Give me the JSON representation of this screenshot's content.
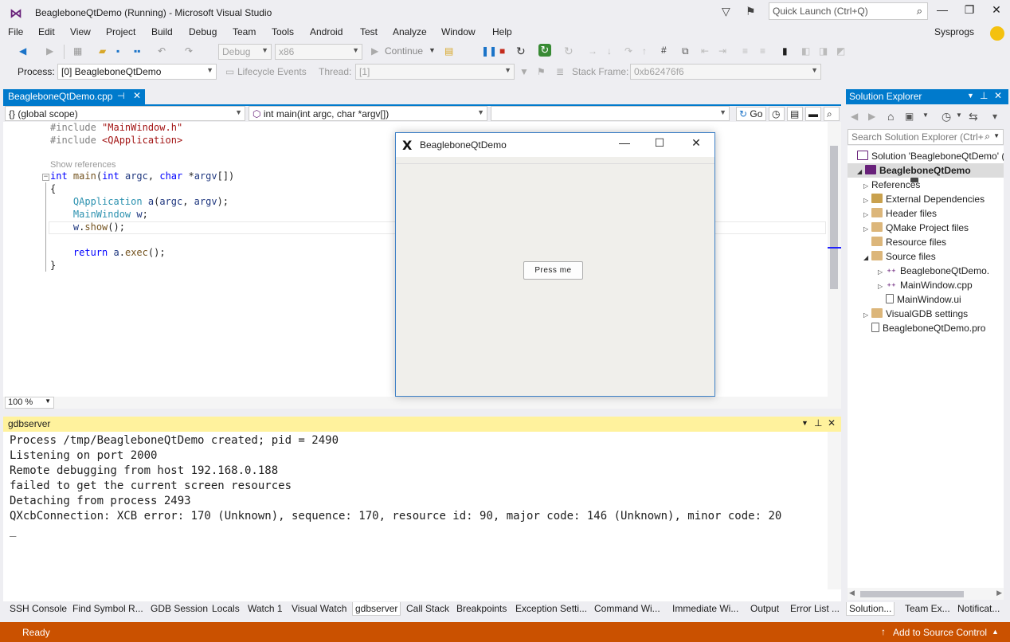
{
  "title_bar": {
    "title": "BeagleboneQtDemo (Running) - Microsoft Visual Studio",
    "quick_launch_placeholder": "Quick Launch (Ctrl+Q)"
  },
  "menu": {
    "items": [
      "File",
      "Edit",
      "View",
      "Project",
      "Build",
      "Debug",
      "Team",
      "Tools",
      "Android",
      "Test",
      "Analyze",
      "Window",
      "Help"
    ],
    "user": "Sysprogs"
  },
  "toolbar": {
    "config": "Debug",
    "platform": "x86",
    "continue_label": "Continue"
  },
  "debug_location": {
    "process_label": "Process:",
    "process_value": "[0] BeagleboneQtDemo",
    "lifecycle_label": "Lifecycle Events",
    "thread_label": "Thread:",
    "thread_value": "[1]",
    "stack_frame_label": "Stack Frame:",
    "stack_frame_value": "0xb62476f6"
  },
  "editor": {
    "tab_label": "BeagleboneQtDemo.cpp",
    "scope": "{} (global scope)",
    "function": "int main(int argc, char *argv[])",
    "go_label": "Go",
    "show_references": "Show references",
    "zoom": "100 %",
    "code_lines": [
      {
        "parts": [
          [
            "pp",
            "#include "
          ],
          [
            "str",
            "\"MainWindow.h\""
          ]
        ]
      },
      {
        "parts": [
          [
            "pp",
            "#include "
          ],
          [
            "str",
            "<QApplication>"
          ]
        ]
      },
      {
        "parts": [
          [
            "kw",
            "int"
          ],
          [
            "",
            " "
          ],
          [
            "fn",
            "main"
          ],
          [
            "",
            "("
          ],
          [
            "kw",
            "int"
          ],
          [
            "",
            " "
          ],
          [
            "va",
            "argc"
          ],
          [
            "",
            ", "
          ],
          [
            "kw",
            "char"
          ],
          [
            "",
            " *"
          ],
          [
            "va",
            "argv"
          ],
          [
            "",
            "[])"
          ]
        ]
      },
      {
        "parts": [
          [
            "",
            "{"
          ]
        ]
      },
      {
        "parts": [
          [
            "",
            "    "
          ],
          [
            "ty",
            "QApplication"
          ],
          [
            "",
            " "
          ],
          [
            "va",
            "a"
          ],
          [
            "",
            "("
          ],
          [
            "va",
            "argc"
          ],
          [
            "",
            ", "
          ],
          [
            "va",
            "argv"
          ],
          [
            "",
            ");"
          ]
        ]
      },
      {
        "parts": [
          [
            "",
            "    "
          ],
          [
            "ty",
            "MainWindow"
          ],
          [
            "",
            " "
          ],
          [
            "va",
            "w"
          ],
          [
            "",
            ";"
          ]
        ]
      },
      {
        "parts": [
          [
            "",
            "    "
          ],
          [
            "va",
            "w"
          ],
          [
            "",
            "."
          ],
          [
            "fn",
            "show"
          ],
          [
            "",
            "();"
          ]
        ]
      },
      {
        "parts": [
          [
            "",
            ""
          ]
        ]
      },
      {
        "parts": [
          [
            "",
            "    "
          ],
          [
            "kw",
            "return"
          ],
          [
            "",
            " "
          ],
          [
            "va",
            "a"
          ],
          [
            "",
            "."
          ],
          [
            "fn",
            "exec"
          ],
          [
            "",
            "();"
          ]
        ]
      },
      {
        "parts": [
          [
            "",
            "}"
          ]
        ]
      }
    ]
  },
  "qt_window": {
    "title": "BeagleboneQtDemo",
    "button_label": "Press me"
  },
  "gdbserver": {
    "title": "gdbserver",
    "output": "Process /tmp/BeagleboneQtDemo created; pid = 2490\nListening on port 2000\nRemote debugging from host 192.168.0.188\nfailed to get the current screen resources\nDetaching from process 2493\nQXcbConnection: XCB error: 170 (Unknown), sequence: 170, resource id: 90, major code: 146 (Unknown), minor code: 20\n_"
  },
  "bottom_tabs": [
    "SSH Console",
    "Find Symbol R...",
    "GDB Session",
    "Locals",
    "Watch 1",
    "Visual Watch",
    "gdbserver",
    "Call Stack",
    "Breakpoints",
    "Exception Setti...",
    "Command Wi...",
    "Immediate Wi...",
    "Output",
    "Error List ..."
  ],
  "bottom_tabs_active": "gdbserver",
  "solution_explorer": {
    "title": "Solution Explorer",
    "search_placeholder": "Search Solution Explorer (Ctrl+",
    "tree": [
      {
        "label": "Solution 'BeagleboneQtDemo' (",
        "icon": "sol",
        "expander": "",
        "bold": false
      },
      {
        "label": "BeagleboneQtDemo",
        "icon": "proj",
        "expander": "◢",
        "bold": true
      },
      {
        "label": "References",
        "icon": "refs",
        "expander": "▷",
        "bold": false
      },
      {
        "label": "External Dependencies",
        "icon": "ext",
        "expander": "▷",
        "bold": false
      },
      {
        "label": "Header files",
        "icon": "folder",
        "expander": "▷",
        "bold": false
      },
      {
        "label": "QMake Project files",
        "icon": "folder",
        "expander": "▷",
        "bold": false
      },
      {
        "label": "Resource files",
        "icon": "folder",
        "expander": "",
        "bold": false
      },
      {
        "label": "Source files",
        "icon": "folder",
        "expander": "◢",
        "bold": false
      },
      {
        "label": "BeagleboneQtDemo.",
        "icon": "cpp",
        "expander": "▷",
        "bold": false
      },
      {
        "label": "MainWindow.cpp",
        "icon": "cpp",
        "expander": "▷",
        "bold": false
      },
      {
        "label": "MainWindow.ui",
        "icon": "file",
        "expander": "",
        "bold": false
      },
      {
        "label": "VisualGDB settings",
        "icon": "gear",
        "expander": "▷",
        "bold": false
      },
      {
        "label": "BeagleboneQtDemo.pro",
        "icon": "file",
        "expander": "",
        "bold": false
      }
    ],
    "bottom_tabs": [
      "Solution...",
      "Team Ex...",
      "Notificat..."
    ]
  },
  "status_bar": {
    "status": "Ready",
    "source_control": "Add to Source Control"
  },
  "colors": {
    "accent": "#007acc",
    "status_bar": "#ca5100",
    "tool_window_active": "#fff29d"
  }
}
